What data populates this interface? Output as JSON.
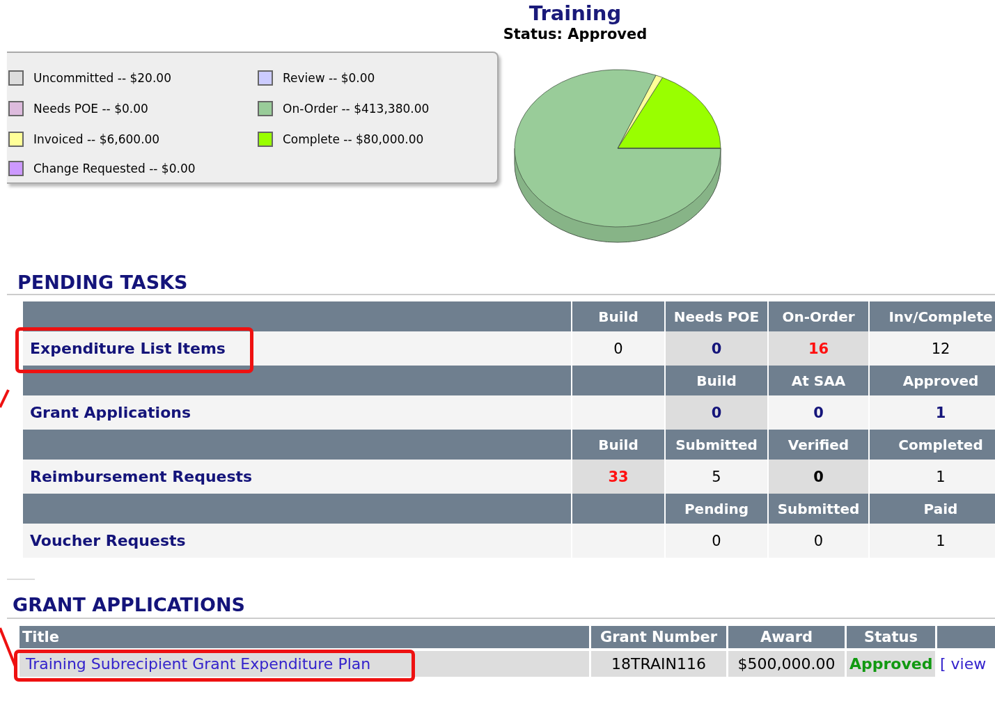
{
  "header": {
    "title": "Training",
    "status": "Status: Approved"
  },
  "legend": [
    {
      "label": "Uncommitted -- $20.00",
      "color": "#dddddd"
    },
    {
      "label": "Review -- $0.00",
      "color": "#ccccff"
    },
    {
      "label": "Needs POE -- $0.00",
      "color": "#ddbbdd"
    },
    {
      "label": "On-Order -- $413,380.00",
      "color": "#99cc99"
    },
    {
      "label": "Invoiced -- $6,600.00",
      "color": "#ffff99"
    },
    {
      "label": "Complete -- $80,000.00",
      "color": "#99ff00"
    },
    {
      "label": "Change Requested -- $0.00",
      "color": "#cc99ff"
    }
  ],
  "pending": {
    "heading": "PENDING TASKS",
    "groups": [
      {
        "name": "Expenditure List Items",
        "highlighted": true,
        "cells": [
          {
            "kind": "count",
            "header": "Build",
            "value": "0",
            "shaded": false
          },
          {
            "kind": "link",
            "header": "Needs POE",
            "value": "0",
            "shaded": true
          },
          {
            "kind": "alert",
            "header": "On-Order",
            "value": "16",
            "shaded": true
          },
          {
            "kind": "count",
            "header": "Inv/Complete",
            "value": "12",
            "shaded": false
          }
        ]
      },
      {
        "name": "Grant Applications",
        "highlighted": false,
        "cells": [
          {
            "kind": "blank"
          },
          {
            "kind": "link",
            "header": "Build",
            "value": "0",
            "shaded": true
          },
          {
            "kind": "link",
            "header": "At SAA",
            "value": "0",
            "shaded": false
          },
          {
            "kind": "link",
            "header": "Approved",
            "value": "1",
            "shaded": false
          }
        ]
      },
      {
        "name": "Reimbursement Requests",
        "highlighted": false,
        "cells": [
          {
            "kind": "alert",
            "header": "Build",
            "value": "33",
            "shaded": true
          },
          {
            "kind": "count",
            "header": "Submitted",
            "value": "5",
            "shaded": false
          },
          {
            "kind": "bold",
            "header": "Verified",
            "value": "0",
            "shaded": true
          },
          {
            "kind": "count",
            "header": "Completed",
            "value": "1",
            "shaded": false
          }
        ]
      },
      {
        "name": "Voucher Requests",
        "highlighted": false,
        "cells": [
          {
            "kind": "blank"
          },
          {
            "kind": "count",
            "header": "Pending",
            "value": "0",
            "shaded": false
          },
          {
            "kind": "count",
            "header": "Submitted",
            "value": "0",
            "shaded": false
          },
          {
            "kind": "count",
            "header": "Paid",
            "value": "1",
            "shaded": false
          }
        ]
      }
    ]
  },
  "grants": {
    "heading": "GRANT APPLICATIONS",
    "columns": [
      "Title",
      "Grant Number",
      "Award",
      "Status"
    ],
    "rows": [
      {
        "title": "Training Subrecipient Grant Expenditure Plan",
        "highlighted": true,
        "grant_number": "18TRAIN116",
        "award": "$500,000.00",
        "status": "Approved",
        "action": "[ view"
      }
    ]
  }
}
